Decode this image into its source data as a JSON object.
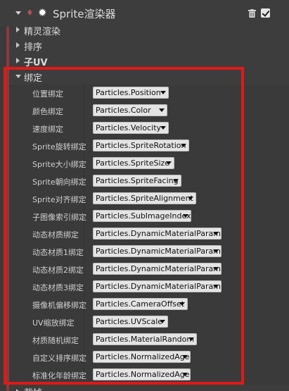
{
  "header": {
    "title": "Sprite渲染器",
    "icons": [
      "collapse-icon",
      "module-icon",
      "sprite-star-icon",
      "trash-icon",
      "enabled-checkbox"
    ],
    "enabled": true
  },
  "categories": [
    {
      "label": "精灵渲染",
      "expanded": false
    },
    {
      "label": "排序",
      "expanded": false
    },
    {
      "label": "子UV",
      "expanded": false
    },
    {
      "label": "绑定",
      "expanded": true
    }
  ],
  "bindings": [
    {
      "label": "位置绑定",
      "value": "Particles.Position"
    },
    {
      "label": "颜色绑定",
      "value": "Particles.Color"
    },
    {
      "label": "速度绑定",
      "value": "Particles.Velocity"
    },
    {
      "label": "Sprite旋转绑定",
      "value": "Particles.SpriteRotation"
    },
    {
      "label": "Sprite大小绑定",
      "value": "Particles.SpriteSize"
    },
    {
      "label": "Sprite朝向绑定",
      "value": "Particles.SpriteFacing"
    },
    {
      "label": "Sprite对齐绑定",
      "value": "Particles.SpriteAlignment"
    },
    {
      "label": "子图像索引绑定",
      "value": "Particles.SubImageIndex"
    },
    {
      "label": "动态材质绑定",
      "value": "Particles.DynamicMaterialParam"
    },
    {
      "label": "动态材质1绑定",
      "value": "Particles.DynamicMaterialParam"
    },
    {
      "label": "动态材质2绑定",
      "value": "Particles.DynamicMaterialParam"
    },
    {
      "label": "动态材质3绑定",
      "value": "Particles.DynamicMaterialParam"
    },
    {
      "label": "摄像机偏移绑定",
      "value": "Particles.CameraOffset"
    },
    {
      "label": "UV缩放绑定",
      "value": "Particles.UVScale"
    },
    {
      "label": "材质随机绑定",
      "value": "Particles.MaterialRandom"
    },
    {
      "label": "自定义排序绑定",
      "value": "Particles.NormalizedAge"
    },
    {
      "label": "标准化年龄绑定",
      "value": "Particles.NormalizedAge"
    }
  ],
  "bottom_category": {
    "label": "裁掉"
  },
  "colors": {
    "background": "#3a3a3a",
    "module_accent": "#8a3a3a",
    "highlight_border": "#e01919",
    "combo_bg": "#e4e4e4"
  }
}
